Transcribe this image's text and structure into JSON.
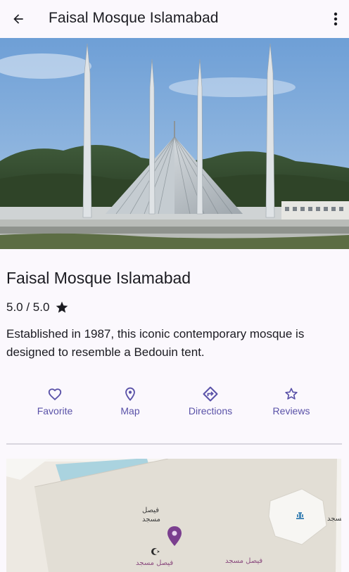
{
  "appbar": {
    "title": "Faisal Mosque Islamabad",
    "back_icon": "arrow-back-icon",
    "menu_icon": "more-vert-icon"
  },
  "hero": {
    "image": "mosque-photo"
  },
  "place": {
    "title": "Faisal Mosque Islamabad",
    "rating_text": "5.0 / 5.0",
    "rating_icon": "star-icon",
    "description": "Established in 1987, this iconic contemporary mosque is designed to resemble a Bedouin tent."
  },
  "actions": [
    {
      "label": "Favorite",
      "icon": "heart-outline-icon"
    },
    {
      "label": "Map",
      "icon": "location-pin-icon"
    },
    {
      "label": "Directions",
      "icon": "directions-icon"
    },
    {
      "label": "Reviews",
      "icon": "star-outline-icon"
    }
  ],
  "map": {
    "labels": {
      "mosque_name_1": "فیصل",
      "mosque_name_2": "مسجد",
      "mosque_full_1": "فیصل مسجد",
      "mosque_full_2": "فیصل مسجد",
      "edge_label": "مسجد"
    }
  },
  "colors": {
    "background": "#fbf8fd",
    "accent": "#5a52a8",
    "text": "#1b1b21",
    "map_pin": "#7b3f8f"
  }
}
